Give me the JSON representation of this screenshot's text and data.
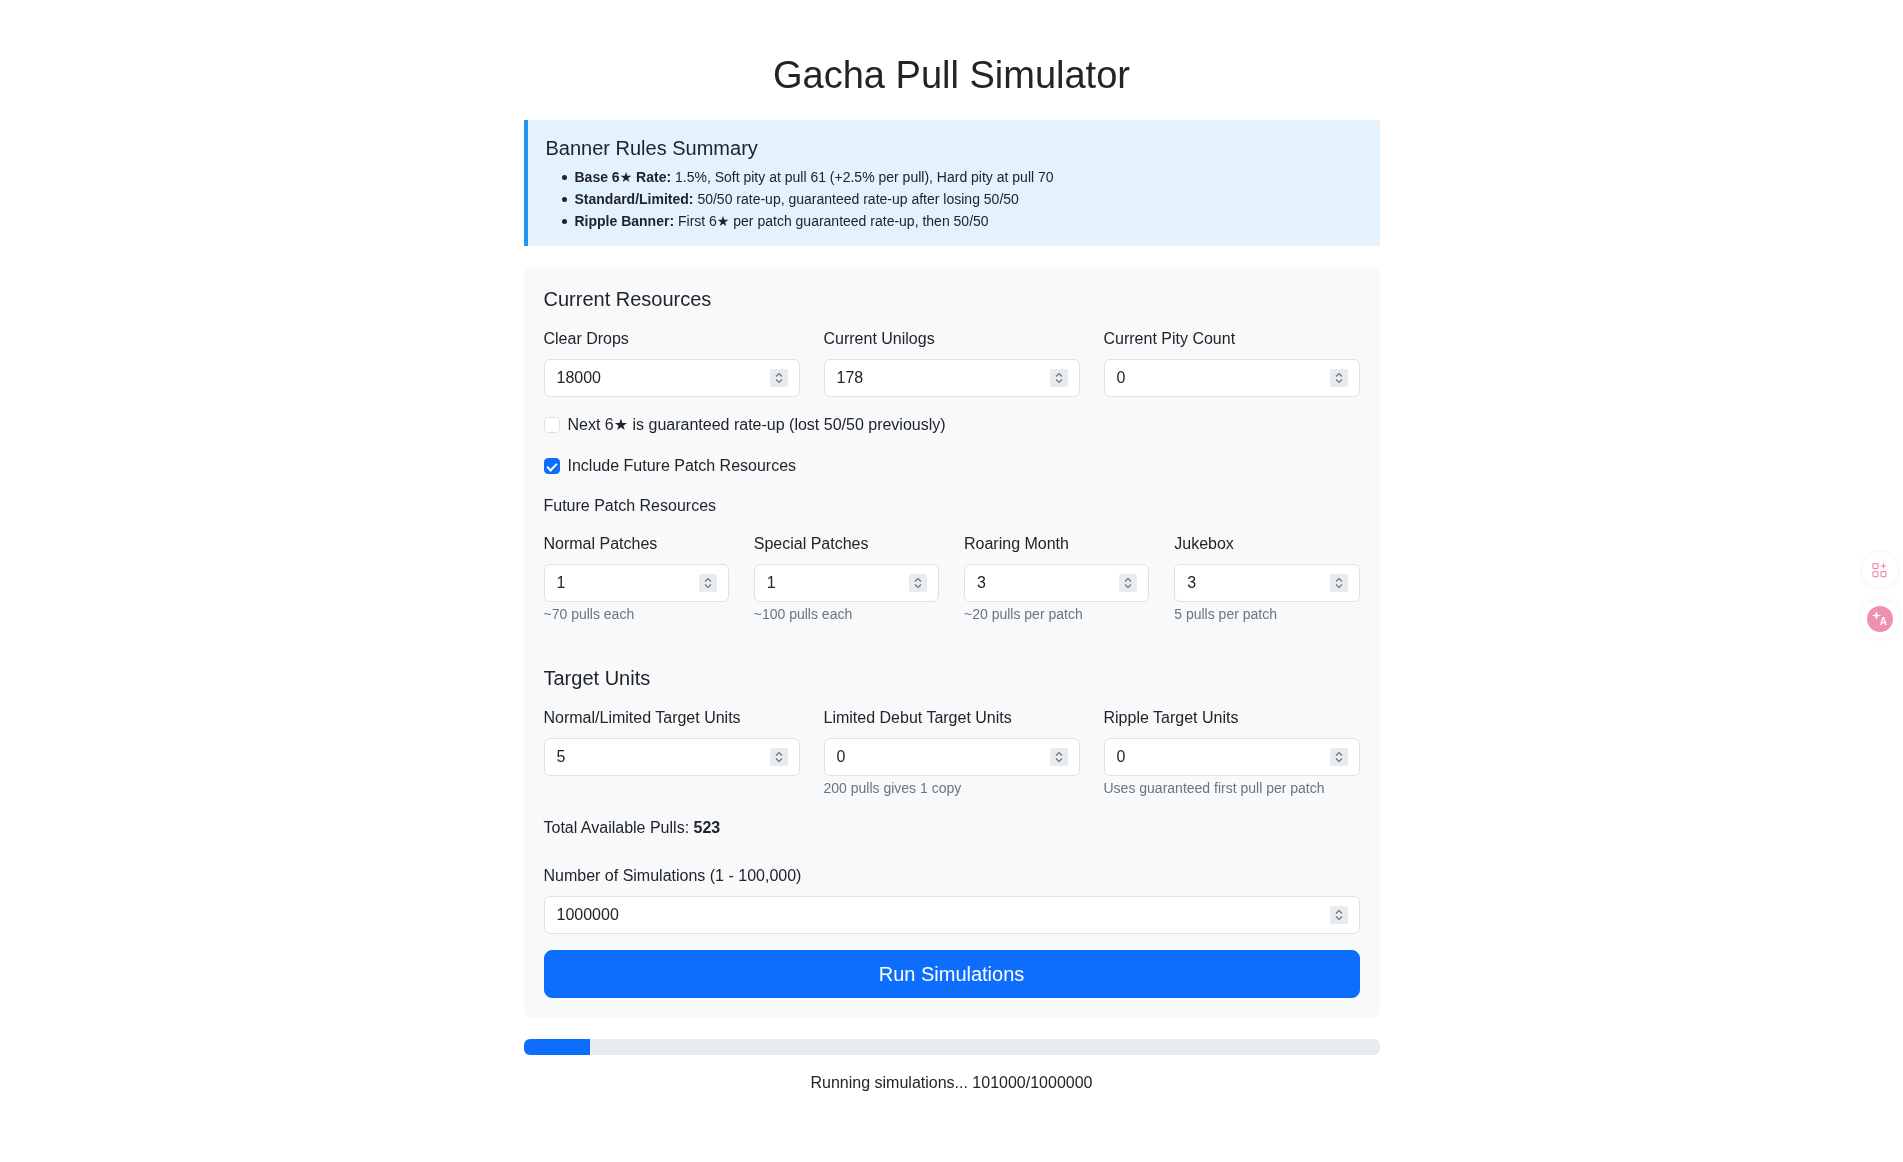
{
  "title": "Gacha Pull Simulator",
  "banner": {
    "heading": "Banner Rules Summary",
    "rules": [
      "**Base 6★ Rate:** 1.5%, Soft pity at pull 61 (+2.5% per pull), Hard pity at pull 70",
      "**Standard/Limited:** 50/50 rate-up, guaranteed rate-up after losing 50/50",
      "**Ripple Banner:** First 6★ per patch guaranteed rate-up, then 50/50"
    ]
  },
  "resources": {
    "heading": "Current Resources",
    "fields": [
      {
        "label": "Clear Drops",
        "value": "18000"
      },
      {
        "label": "Current Unilogs",
        "value": "178"
      },
      {
        "label": "Current Pity Count",
        "value": "0"
      }
    ],
    "options": [
      {
        "label": "Next 6★ is guaranteed rate-up (lost 50/50 previously)",
        "checked": false
      },
      {
        "label": "Include Future Patch Resources",
        "checked": true
      }
    ]
  },
  "future": {
    "heading": "Future Patch Resources",
    "fields": [
      {
        "label": "Normal Patches",
        "value": "1",
        "hint": "~70 pulls each"
      },
      {
        "label": "Special Patches",
        "value": "1",
        "hint": "~100 pulls each"
      },
      {
        "label": "Roaring Month",
        "value": "3",
        "hint": "~20 pulls per patch"
      },
      {
        "label": "Jukebox",
        "value": "3",
        "hint": "5 pulls per patch"
      }
    ]
  },
  "targets": {
    "heading": "Target Units",
    "fields": [
      {
        "label": "Normal/Limited Target Units",
        "value": "5"
      },
      {
        "label": "Limited Debut Target Units",
        "value": "0",
        "hint": "200 pulls gives 1 copy"
      },
      {
        "label": "Ripple Target Units",
        "value": "0",
        "hint": "Uses guaranteed first pull per patch"
      }
    ],
    "total": "Total Available Pulls: **523**"
  },
  "simulations": {
    "label": "Number of Simulations (1 - 100,000)",
    "value": "1000000"
  },
  "run_button": "Run Simulations",
  "progress": {
    "level": 0.078,
    "status": "Running simulations... 101000/1000000"
  },
  "side_tools": [
    {
      "kind": "apps"
    },
    {
      "kind": "translate",
      "glyph": "A"
    }
  ]
}
